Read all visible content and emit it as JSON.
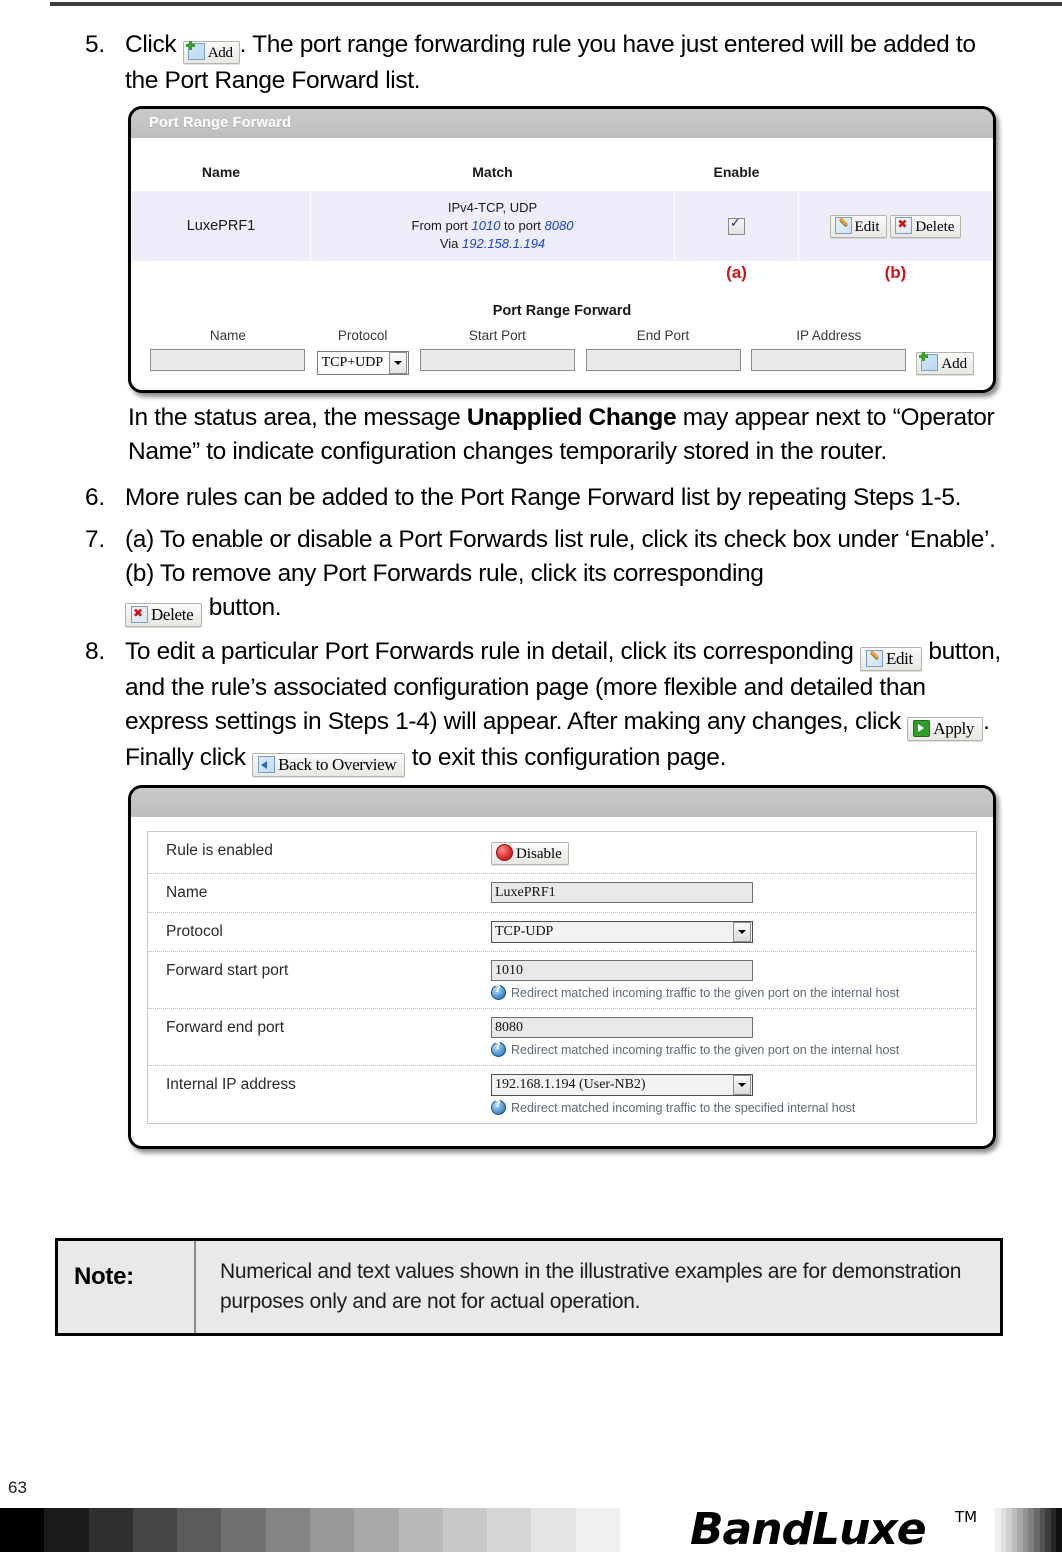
{
  "page_number": "63",
  "steps": [
    {
      "num": "5.",
      "text_before": "Click",
      "button": "Add",
      "text_after": ". The port range forwarding rule you have just entered will be added to the Port Range Forward list."
    },
    {
      "num": "6.",
      "text": "More rules can be added to the Port Range Forward list by repeating Steps 1-5."
    },
    {
      "num": "7.",
      "line_a": "(a) To enable or disable a Port Forwards list rule, click its check box under ‘Enable’.",
      "line_b": "(b) To remove any Port Forwards rule, click its corresponding",
      "button": "Delete",
      "line_b_tail": "button."
    },
    {
      "num": "8.",
      "part1": "To edit a particular Port Forwards rule in detail, click its corresponding",
      "button_edit": "Edit",
      "part2": "button, and the rule’s associated configuration page (more flexible and detailed than express settings in Steps 1-4) will appear. After making any changes, click",
      "button_apply": "Apply",
      "part3": ". Finally click",
      "button_back": "Back to Overview",
      "part4": "to exit this configuration page."
    }
  ],
  "status_note": {
    "part1": "In the status area, the message ",
    "bold": "Unapplied Change",
    "part2": " may appear next to “Operator Name” to indicate configuration changes temporarily stored in the router."
  },
  "port_range_forward_panel": {
    "title": "Port Range Forward",
    "columns": [
      "Name",
      "Match",
      "Enable",
      ""
    ],
    "rows": [
      {
        "name": "LuxePRF1",
        "match_protocol": "IPv4-TCP, UDP",
        "match_from_label": "From port",
        "match_from_port": "1010",
        "match_to_label": "to port",
        "match_to_port": "8080",
        "match_via_label": "Via",
        "match_via_ip": "192.158.1.194",
        "enabled": true,
        "edit_label": "Edit",
        "delete_label": "Delete"
      }
    ],
    "annotations": {
      "enable": "(a)",
      "actions": "(b)"
    },
    "add_form": {
      "title": "Port Range Forward",
      "headers": [
        "Name",
        "Protocol",
        "Start Port",
        "End Port",
        "IP Address"
      ],
      "name_value": "",
      "protocol_value": "TCP+UDP",
      "start_port_value": "",
      "end_port_value": "",
      "ip_address_value": "",
      "add_label": "Add"
    }
  },
  "rule_config_panel": {
    "title": "",
    "rows": [
      {
        "label": "Rule is enabled",
        "type": "button",
        "value": "Disable",
        "hint": ""
      },
      {
        "label": "Name",
        "type": "text",
        "value": "LuxePRF1",
        "hint": ""
      },
      {
        "label": "Protocol",
        "type": "select",
        "value": "TCP-UDP",
        "hint": ""
      },
      {
        "label": "Forward start port",
        "type": "text",
        "value": "1010",
        "hint": "Redirect matched incoming traffic to the given port on the internal host"
      },
      {
        "label": "Forward end port",
        "type": "text",
        "value": "8080",
        "hint": "Redirect matched incoming traffic to the given port on the internal host"
      },
      {
        "label": "Internal IP address",
        "type": "select",
        "value": "192.168.1.194 (User-NB2)",
        "hint": "Redirect matched incoming traffic to the specified internal host"
      }
    ]
  },
  "note": {
    "label": "Note:",
    "text": "Numerical and text values shown in the illustrative examples are for demonstration purposes only and are not for actual operation."
  },
  "footer": {
    "brand": "BandLuxe",
    "trademark": "TM"
  },
  "colors": {
    "annotation_red": "#d01414",
    "link_blue": "#1c43c9",
    "panel_header_gray": "#c4c4c4",
    "row_lavender": "#eeeefb"
  }
}
